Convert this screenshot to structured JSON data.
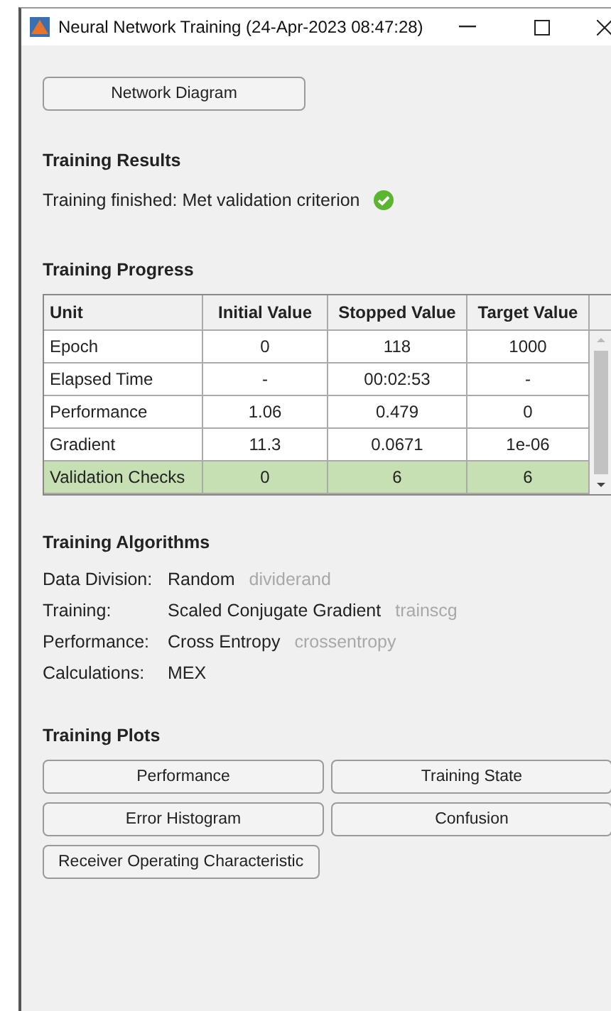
{
  "window": {
    "title": "Neural Network Training (24-Apr-2023 08:47:28)"
  },
  "top_button": "Network Diagram",
  "results": {
    "heading": "Training Results",
    "status": "Training finished: Met validation criterion",
    "success": true
  },
  "progress": {
    "heading": "Training Progress",
    "columns": [
      "Unit",
      "Initial Value",
      "Stopped Value",
      "Target Value"
    ],
    "rows": [
      {
        "cells": [
          "Epoch",
          "0",
          "118",
          "1000"
        ],
        "highlighted": false
      },
      {
        "cells": [
          "Elapsed Time",
          "-",
          "00:02:53",
          "-"
        ],
        "highlighted": false
      },
      {
        "cells": [
          "Performance",
          "1.06",
          "0.479",
          "0"
        ],
        "highlighted": false
      },
      {
        "cells": [
          "Gradient",
          "11.3",
          "0.0671",
          "1e-06"
        ],
        "highlighted": false
      },
      {
        "cells": [
          "Validation Checks",
          "0",
          "6",
          "6"
        ],
        "highlighted": true
      }
    ]
  },
  "algorithms": {
    "heading": "Training Algorithms",
    "rows": [
      {
        "label": "Data Division:",
        "value": "Random",
        "function": "dividerand"
      },
      {
        "label": "Training:",
        "value": "Scaled Conjugate Gradient",
        "function": "trainscg"
      },
      {
        "label": "Performance:",
        "value": "Cross Entropy",
        "function": "crossentropy"
      },
      {
        "label": "Calculations:",
        "value": "MEX"
      }
    ]
  },
  "plots": {
    "heading": "Training Plots",
    "buttons": [
      "Performance",
      "Training State",
      "Error Histogram",
      "Confusion",
      "Receiver Operating Characteristic"
    ]
  }
}
